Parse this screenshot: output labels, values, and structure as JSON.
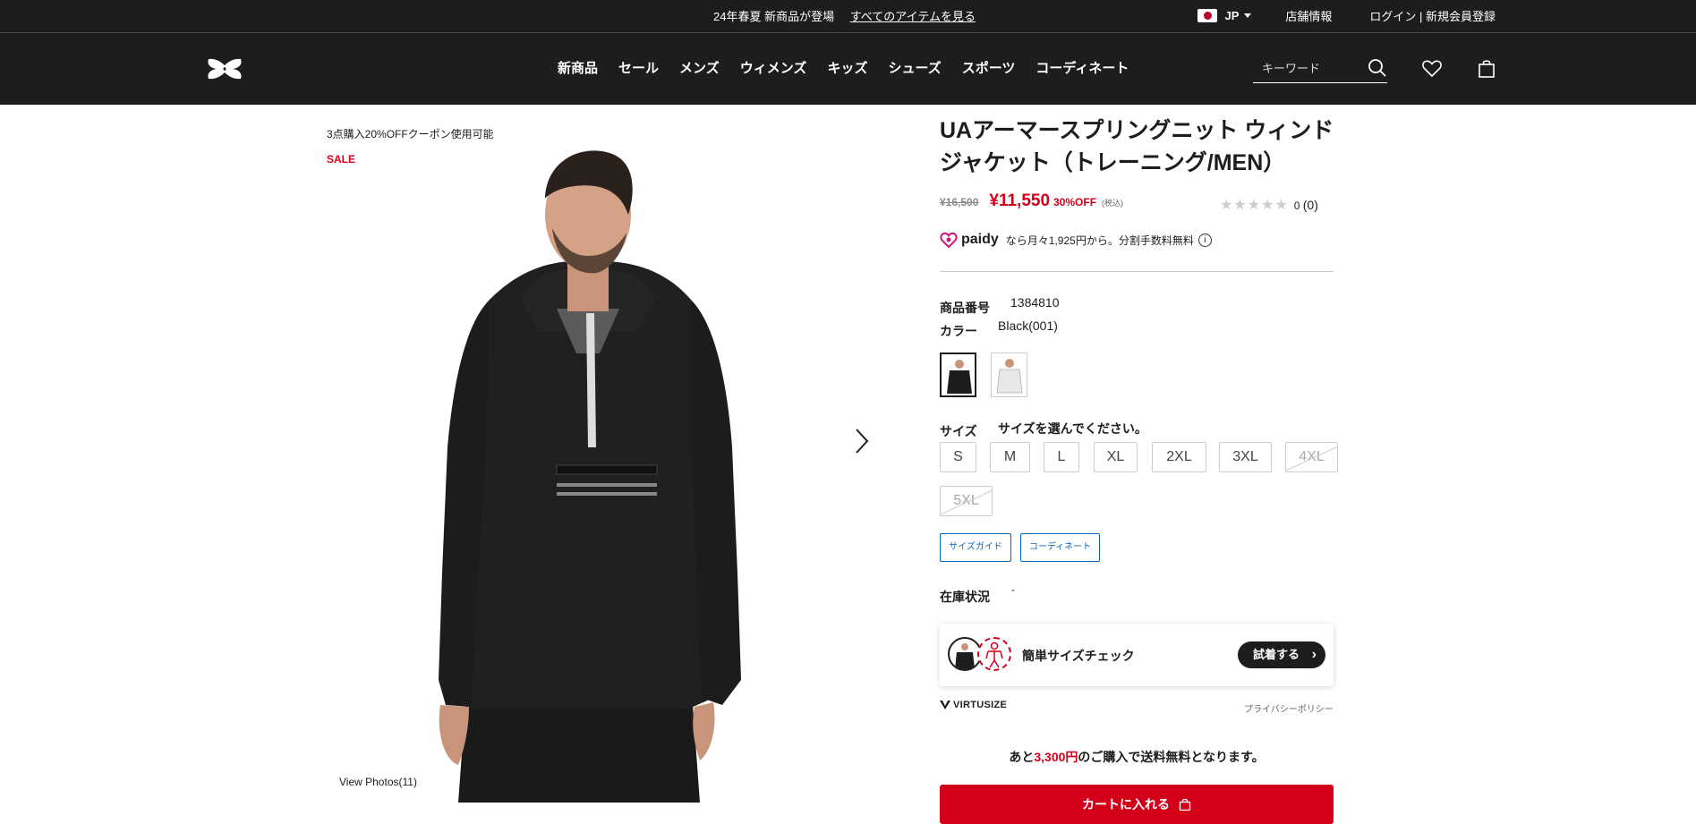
{
  "topbar": {
    "announcement": "24年春夏 新商品が登場",
    "view_all_link": "すべてのアイテムを見る",
    "country": "JP",
    "stores": "店舗情報",
    "login": "ログイン | 新規会員登録"
  },
  "header": {
    "nav": [
      "新商品",
      "セール",
      "メンズ",
      "ウィメンズ",
      "キッズ",
      "シューズ",
      "スポーツ",
      "コーディネート"
    ],
    "search_placeholder": "キーワード"
  },
  "gallery": {
    "coupon": "3点購入20%OFFクーポン使用可能",
    "sale_tag": "SALE",
    "view_photos": "View Photos(11)"
  },
  "product": {
    "title": "UAアーマースプリングニット ウィンドジャケット（トレーニング/MEN）",
    "price_original": "¥16,500",
    "price_sale": "¥11,550",
    "discount": "30%OFF",
    "tax": "(税込)",
    "rating_stars": 0,
    "rating_score": "0",
    "rating_reviews": "(0)",
    "paidy_brand": "paidy",
    "paidy_text": "なら月々1,925円から。分割手数料無料",
    "item_number_label": "商品番号",
    "item_number": "1384810",
    "color_label": "カラー",
    "color_value": "Black(001)",
    "size_label": "サイズ",
    "size_prompt": "サイズを選んでください。",
    "sizes": [
      {
        "label": "S",
        "available": true
      },
      {
        "label": "M",
        "available": true
      },
      {
        "label": "L",
        "available": true
      },
      {
        "label": "XL",
        "available": true
      },
      {
        "label": "2XL",
        "available": true
      },
      {
        "label": "3XL",
        "available": true
      },
      {
        "label": "4XL",
        "available": false
      },
      {
        "label": "5XL",
        "available": false
      }
    ],
    "size_guide": "サイズガイド",
    "coordinate": "コーディネート",
    "stock_label": "在庫状況",
    "stock_value": "-"
  },
  "virtusize": {
    "check_text": "簡単サイズチェック",
    "try_button": "試着する",
    "brand": "VIRTUSIZE",
    "privacy": "プライバシーポリシー"
  },
  "shipping": {
    "prefix": "あと",
    "amount": "3,300円",
    "suffix": "のご購入で送料無料となります。"
  },
  "cart": {
    "label": "カートに入れる"
  },
  "colors": {
    "header_bg": "#1d1d1d",
    "sale_red": "#d4001a",
    "link_blue": "#0a62b8"
  }
}
